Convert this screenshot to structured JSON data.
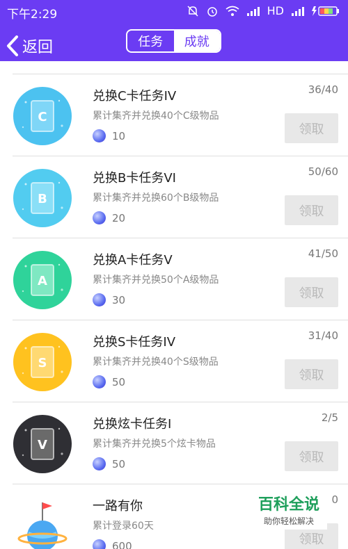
{
  "status_bar": {
    "time": "下午2:29",
    "network": "HD"
  },
  "header": {
    "back_label": "返回",
    "tabs": [
      {
        "label": "任务",
        "active": false
      },
      {
        "label": "成就",
        "active": true
      }
    ]
  },
  "tasks": [
    {
      "title": "兑换C卡任务IV",
      "description": "累计集齐并兑换40个C级物品",
      "reward": "10",
      "progress": "36/40",
      "claim_label": "领取",
      "badge": {
        "letter": "C",
        "bg": "#4cc2f0",
        "card": "#7fd6f7",
        "icon": "card-c-icon"
      }
    },
    {
      "title": "兑换B卡任务VI",
      "description": "累计集齐并兑换60个B级物品",
      "reward": "20",
      "progress": "50/60",
      "claim_label": "领取",
      "badge": {
        "letter": "B",
        "bg": "#52ccf0",
        "card": "#8adff7",
        "icon": "card-b-icon"
      }
    },
    {
      "title": "兑换A卡任务V",
      "description": "累计集齐并兑换50个A级物品",
      "reward": "30",
      "progress": "41/50",
      "claim_label": "领取",
      "badge": {
        "letter": "A",
        "bg": "#2fd39a",
        "card": "#7fe8c2",
        "icon": "card-a-icon"
      }
    },
    {
      "title": "兑换S卡任务IV",
      "description": "累计集齐并兑换40个S级物品",
      "reward": "50",
      "progress": "31/40",
      "claim_label": "领取",
      "badge": {
        "letter": "S",
        "bg": "#ffc21f",
        "card": "#ffd972",
        "icon": "card-s-icon"
      }
    },
    {
      "title": "兑换炫卡任务I",
      "description": "累计集齐并兑换5个炫卡物品",
      "reward": "50",
      "progress": "2/5",
      "claim_label": "领取",
      "badge": {
        "letter": "V",
        "bg": "#2f2f34",
        "card": "#6a6a6a",
        "icon": "card-v-icon"
      }
    },
    {
      "title": "一路有你",
      "description": "累计登录60天",
      "reward": "600",
      "progress": "0",
      "claim_label": "领取",
      "badge": {
        "letter": "",
        "bg": "#ffffff",
        "card": "#4aa8f2",
        "icon": "planet-flag-icon"
      }
    }
  ],
  "watermark": {
    "title": "百科全说",
    "subtitle": "助你轻松解决"
  },
  "colors": {
    "primary": "#6b3cf3",
    "coin": "#5a6cf0",
    "disabled_button": "#e8e8e8"
  }
}
